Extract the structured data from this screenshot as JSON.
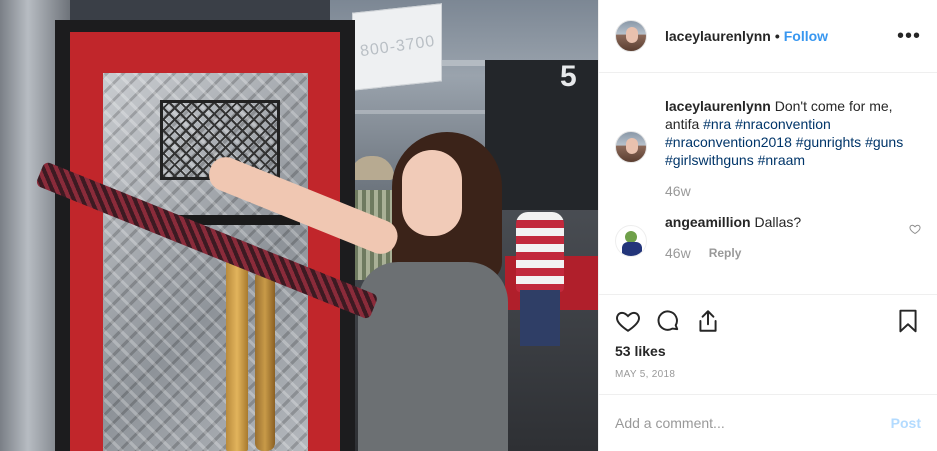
{
  "post": {
    "username": "laceylaurenlynn",
    "dot": "•",
    "follow_label": "Follow",
    "more_icon": "more-options-icon"
  },
  "caption": {
    "username": "laceylaurenlynn",
    "text": "Don't come for me, antifa",
    "tags": [
      "#nra",
      "#nraconvention",
      "#nraconvention2018",
      "#gunrights",
      "#guns",
      "#girlswithguns",
      "#nraam"
    ],
    "time": "46w"
  },
  "comment": {
    "username": "angeamillion",
    "text": "Dallas?",
    "time": "46w",
    "reply_label": "Reply"
  },
  "photo": {
    "banner_text": "800-3700",
    "booth_number": "5"
  },
  "likes": "53 likes",
  "date": "MAY 5, 2018",
  "add_comment": {
    "placeholder": "Add a comment...",
    "post_label": "Post"
  },
  "colors": {
    "accent": "#3897f0",
    "post_disabled": "#b3dbff",
    "hashtag": "#003569",
    "muted": "#999999"
  }
}
